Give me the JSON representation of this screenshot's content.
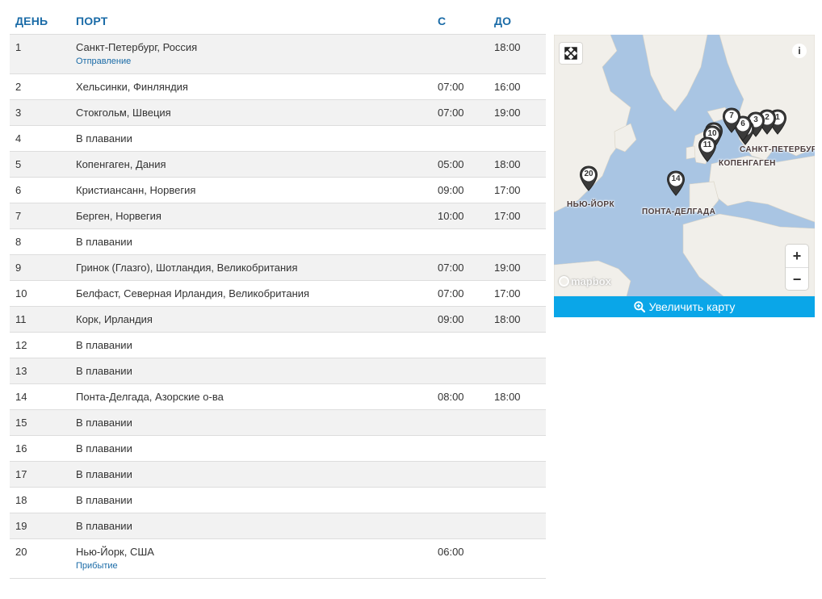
{
  "table": {
    "headers": {
      "day": "ДЕНЬ",
      "port": "ПОРТ",
      "from": "С",
      "to": "ДО"
    },
    "rows": [
      {
        "day": "1",
        "port": "Санкт-Петербург, Россия",
        "note": "Отправление",
        "from": "",
        "to": "18:00"
      },
      {
        "day": "2",
        "port": "Хельсинки, Финляндия",
        "note": "",
        "from": "07:00",
        "to": "16:00"
      },
      {
        "day": "3",
        "port": "Стокгольм, Швеция",
        "note": "",
        "from": "07:00",
        "to": "19:00"
      },
      {
        "day": "4",
        "port": "В плавании",
        "note": "",
        "from": "",
        "to": ""
      },
      {
        "day": "5",
        "port": "Копенгаген, Дания",
        "note": "",
        "from": "05:00",
        "to": "18:00"
      },
      {
        "day": "6",
        "port": "Кристиансанн, Норвегия",
        "note": "",
        "from": "09:00",
        "to": "17:00"
      },
      {
        "day": "7",
        "port": "Берген, Норвегия",
        "note": "",
        "from": "10:00",
        "to": "17:00"
      },
      {
        "day": "8",
        "port": "В плавании",
        "note": "",
        "from": "",
        "to": ""
      },
      {
        "day": "9",
        "port": "Гринок (Глазго), Шотландия, Великобритания",
        "note": "",
        "from": "07:00",
        "to": "19:00"
      },
      {
        "day": "10",
        "port": "Белфаст, Северная Ирландия, Великобритания",
        "note": "",
        "from": "07:00",
        "to": "17:00"
      },
      {
        "day": "11",
        "port": "Корк, Ирландия",
        "note": "",
        "from": "09:00",
        "to": "18:00"
      },
      {
        "day": "12",
        "port": "В плавании",
        "note": "",
        "from": "",
        "to": ""
      },
      {
        "day": "13",
        "port": "В плавании",
        "note": "",
        "from": "",
        "to": ""
      },
      {
        "day": "14",
        "port": "Понта-Делгада, Азорские о-ва",
        "note": "",
        "from": "08:00",
        "to": "18:00"
      },
      {
        "day": "15",
        "port": "В плавании",
        "note": "",
        "from": "",
        "to": ""
      },
      {
        "day": "16",
        "port": "В плавании",
        "note": "",
        "from": "",
        "to": ""
      },
      {
        "day": "17",
        "port": "В плавании",
        "note": "",
        "from": "",
        "to": ""
      },
      {
        "day": "18",
        "port": "В плавании",
        "note": "",
        "from": "",
        "to": ""
      },
      {
        "day": "19",
        "port": "В плавании",
        "note": "",
        "from": "",
        "to": ""
      },
      {
        "day": "20",
        "port": "Нью-Йорк, США",
        "note": "Прибытие",
        "from": "06:00",
        "to": ""
      }
    ]
  },
  "map": {
    "labels": {
      "spb": "САНКТ-ПЕТЕРБУРГ",
      "copenhagen": "КОПЕНГАГЕН",
      "newyork": "НЬЮ-ЙОРК",
      "pontadelgada": "ПОНТА-ДЕЛГАДА"
    },
    "pins": [
      "1",
      "2",
      "3",
      "5",
      "6",
      "7",
      "9",
      "10",
      "11",
      "14",
      "20"
    ],
    "logo": "mapbox",
    "info": "i",
    "zoom_in": "+",
    "zoom_out": "−",
    "enlarge_label": "Увеличить карту"
  },
  "colors": {
    "header_text": "#1a6ba7",
    "row_alt": "#f2f2f2",
    "water": "#a9c5e3",
    "land": "#f1efea",
    "button": "#0aa6e8"
  },
  "icons": {
    "fullscreen": "expand-arrows-icon",
    "info": "info-icon",
    "enlarge": "zoom-in-icon",
    "pin": "map-pin-icon"
  }
}
